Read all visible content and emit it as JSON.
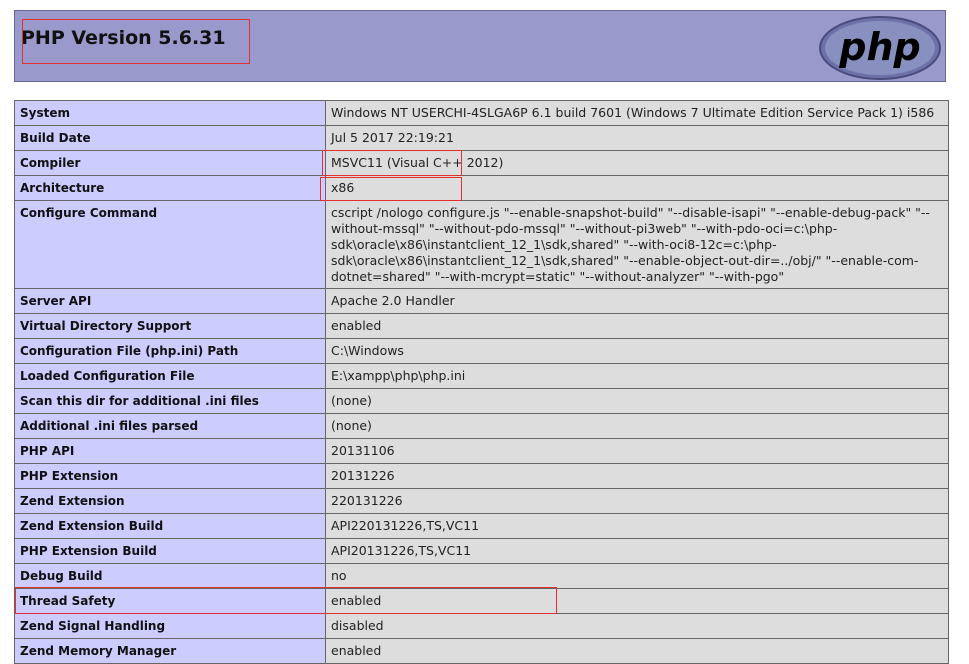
{
  "header": {
    "title": "PHP Version 5.6.31",
    "logo_text": "php"
  },
  "rows": [
    {
      "label": "System",
      "value": "Windows NT USERCHI-4SLGA6P 6.1 build 7601 (Windows 7 Ultimate Edition Service Pack 1) i586"
    },
    {
      "label": "Build Date",
      "value": "Jul 5 2017 22:19:21"
    },
    {
      "label": "Compiler",
      "value": "MSVC11 (Visual C++ 2012)"
    },
    {
      "label": "Architecture",
      "value": "x86"
    },
    {
      "label": "Configure Command",
      "value": "cscript /nologo configure.js \"--enable-snapshot-build\" \"--disable-isapi\" \"--enable-debug-pack\" \"--without-mssql\" \"--without-pdo-mssql\" \"--without-pi3web\" \"--with-pdo-oci=c:\\php-sdk\\oracle\\x86\\instantclient_12_1\\sdk,shared\" \"--with-oci8-12c=c:\\php-sdk\\oracle\\x86\\instantclient_12_1\\sdk,shared\" \"--enable-object-out-dir=../obj/\" \"--enable-com-dotnet=shared\" \"--with-mcrypt=static\" \"--without-analyzer\" \"--with-pgo\""
    },
    {
      "label": "Server API",
      "value": "Apache 2.0 Handler"
    },
    {
      "label": "Virtual Directory Support",
      "value": "enabled"
    },
    {
      "label": "Configuration File (php.ini) Path",
      "value": "C:\\Windows"
    },
    {
      "label": "Loaded Configuration File",
      "value": "E:\\xampp\\php\\php.ini"
    },
    {
      "label": "Scan this dir for additional .ini files",
      "value": "(none)"
    },
    {
      "label": "Additional .ini files parsed",
      "value": "(none)"
    },
    {
      "label": "PHP API",
      "value": "20131106"
    },
    {
      "label": "PHP Extension",
      "value": "20131226"
    },
    {
      "label": "Zend Extension",
      "value": "220131226"
    },
    {
      "label": "Zend Extension Build",
      "value": "API220131226,TS,VC11"
    },
    {
      "label": "PHP Extension Build",
      "value": "API20131226,TS,VC11"
    },
    {
      "label": "Debug Build",
      "value": "no"
    },
    {
      "label": "Thread Safety",
      "value": "enabled"
    },
    {
      "label": "Zend Signal Handling",
      "value": "disabled"
    },
    {
      "label": "Zend Memory Manager",
      "value": "enabled"
    }
  ],
  "colors": {
    "header_bg": "#9999cc",
    "label_bg": "#ccccff",
    "value_bg": "#dddddd",
    "highlight": "#e03030"
  }
}
